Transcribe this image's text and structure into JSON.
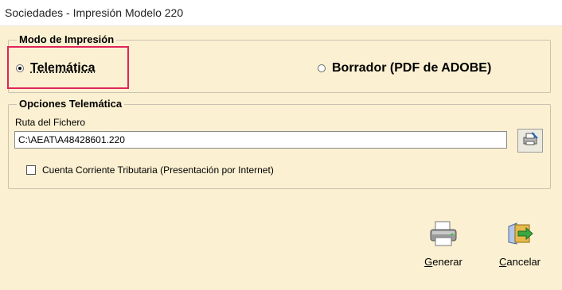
{
  "window": {
    "title": "Sociedades - Impresión Modelo 220"
  },
  "modo": {
    "legend": "Modo de Impresión",
    "options": [
      {
        "label": "Telemática",
        "checked": true
      },
      {
        "label": "Borrador (PDF de ADOBE)",
        "checked": false
      }
    ]
  },
  "telematica": {
    "legend": "Opciones Telemática",
    "path_label": "Ruta del Fichero",
    "path_value": "C:\\AEAT\\A48428601.220",
    "checkbox_label": "Cuenta Corriente Tributaria  (Presentación por Internet)",
    "checkbox_checked": false
  },
  "actions": {
    "generar": {
      "mnemonic": "G",
      "rest": "enerar"
    },
    "cancelar": {
      "mnemonic": "C",
      "rest": "ancelar"
    }
  },
  "colors": {
    "background": "#fbf0d1",
    "highlight": "#e0245a"
  }
}
